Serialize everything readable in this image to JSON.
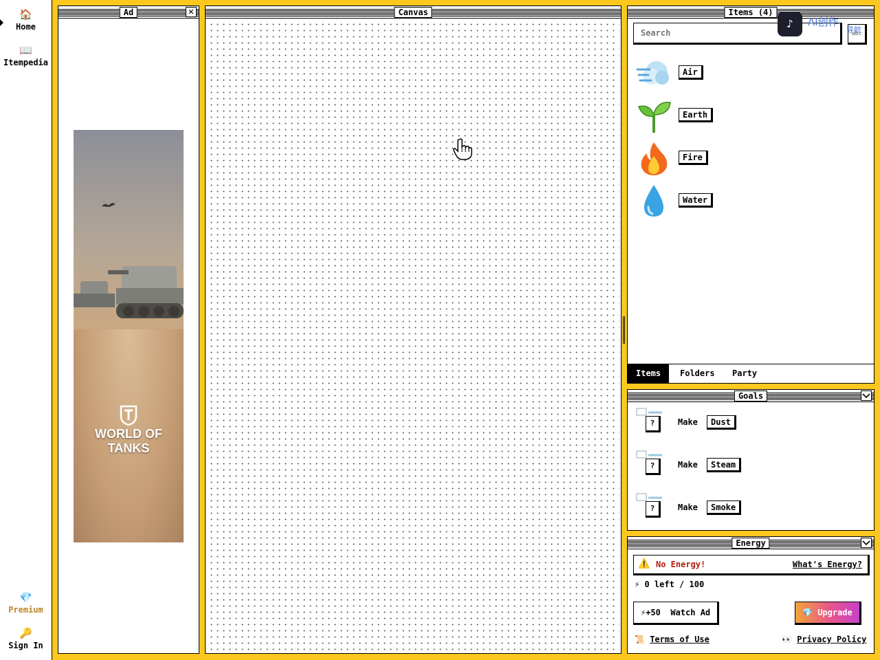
{
  "nav": {
    "home": {
      "icon": "house-icon",
      "label": "Home"
    },
    "itempedia": {
      "icon": "book-icon",
      "label": "Itempedia"
    },
    "premium": {
      "icon": "gem-icon",
      "label": "Premium"
    },
    "signin": {
      "icon": "key-icon",
      "label": "Sign In"
    }
  },
  "ad": {
    "title": "Ad",
    "close": "✕",
    "brand": "WORLD OF TANKS"
  },
  "canvas": {
    "title": "Canvas"
  },
  "items": {
    "title": "Items (4)",
    "search_placeholder": "Search",
    "sort_label": "abc",
    "watermark_text": "AI创作",
    "watermark_sub": "导航",
    "list": [
      {
        "name": "Air",
        "icon": "wind-icon"
      },
      {
        "name": "Earth",
        "icon": "seedling-icon"
      },
      {
        "name": "Fire",
        "icon": "fire-icon"
      },
      {
        "name": "Water",
        "icon": "droplet-icon"
      }
    ],
    "tabs": [
      "Items",
      "Folders",
      "Party"
    ],
    "active_tab": "Items"
  },
  "goals": {
    "title": "Goals",
    "make_label": "Make",
    "unknown": "?",
    "list": [
      "Dust",
      "Steam",
      "Smoke"
    ]
  },
  "energy": {
    "title": "Energy",
    "status": "No Energy!",
    "help_link": "What's Energy?",
    "count_text": "0 left / 100",
    "left": 0,
    "max": 100,
    "watch_ad": "+50  Watch Ad",
    "upgrade": "Upgrade",
    "terms": "Terms of Use",
    "privacy": "Privacy Policy"
  },
  "colors": {
    "frame": "#fcc81e",
    "premium": "#b8862a",
    "warning_text": "#b21d0f"
  }
}
